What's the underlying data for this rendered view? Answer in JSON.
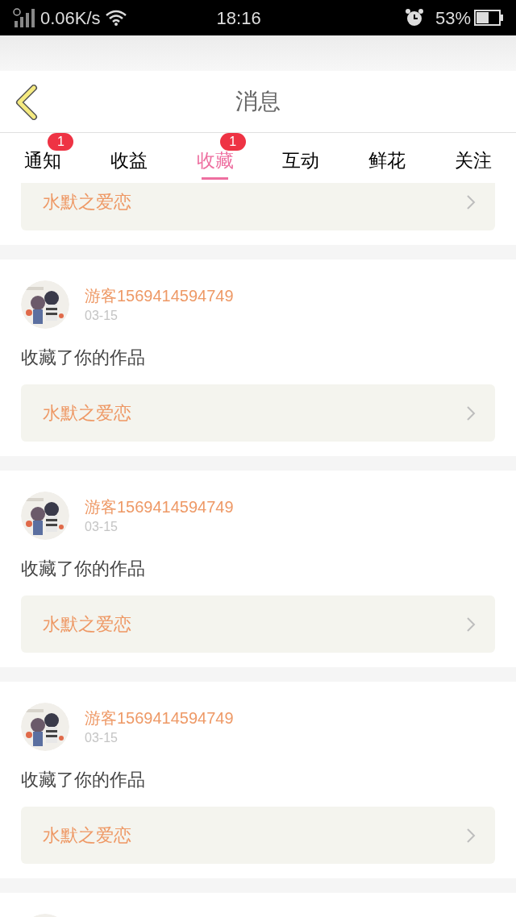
{
  "status_bar": {
    "speed": "0.06K/s",
    "time": "18:16",
    "battery": "53%"
  },
  "header": {
    "title": "消息"
  },
  "tabs": [
    {
      "label": "通知",
      "selected": false,
      "badge": "1"
    },
    {
      "label": "收益",
      "selected": false
    },
    {
      "label": "收藏",
      "selected": true,
      "badge": "1"
    },
    {
      "label": "互动",
      "selected": false
    },
    {
      "label": "鲜花",
      "selected": false
    },
    {
      "label": "关注",
      "selected": false
    }
  ],
  "messages": [
    {
      "kind": "link_only",
      "work": "水默之爱恋"
    },
    {
      "kind": "full",
      "user": "游客1569414594749",
      "date": "03-15",
      "text": "收藏了你的作品",
      "work": "水默之爱恋"
    },
    {
      "kind": "full",
      "user": "游客1569414594749",
      "date": "03-15",
      "text": "收藏了你的作品",
      "work": "水默之爱恋"
    },
    {
      "kind": "full",
      "user": "游客1569414594749",
      "date": "03-15",
      "text": "收藏了你的作品",
      "work": "水默之爱恋"
    },
    {
      "kind": "avatar_only"
    }
  ]
}
